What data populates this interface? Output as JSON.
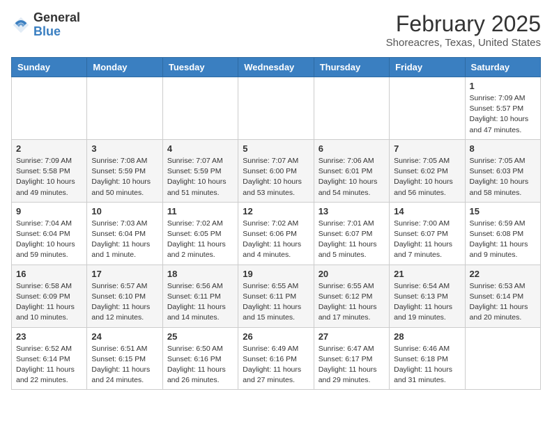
{
  "header": {
    "logo_general": "General",
    "logo_blue": "Blue",
    "month_year": "February 2025",
    "location": "Shoreacres, Texas, United States"
  },
  "weekdays": [
    "Sunday",
    "Monday",
    "Tuesday",
    "Wednesday",
    "Thursday",
    "Friday",
    "Saturday"
  ],
  "weeks": [
    [
      {
        "day": "",
        "info": ""
      },
      {
        "day": "",
        "info": ""
      },
      {
        "day": "",
        "info": ""
      },
      {
        "day": "",
        "info": ""
      },
      {
        "day": "",
        "info": ""
      },
      {
        "day": "",
        "info": ""
      },
      {
        "day": "1",
        "info": "Sunrise: 7:09 AM\nSunset: 5:57 PM\nDaylight: 10 hours and 47 minutes."
      }
    ],
    [
      {
        "day": "2",
        "info": "Sunrise: 7:09 AM\nSunset: 5:58 PM\nDaylight: 10 hours and 49 minutes."
      },
      {
        "day": "3",
        "info": "Sunrise: 7:08 AM\nSunset: 5:59 PM\nDaylight: 10 hours and 50 minutes."
      },
      {
        "day": "4",
        "info": "Sunrise: 7:07 AM\nSunset: 5:59 PM\nDaylight: 10 hours and 51 minutes."
      },
      {
        "day": "5",
        "info": "Sunrise: 7:07 AM\nSunset: 6:00 PM\nDaylight: 10 hours and 53 minutes."
      },
      {
        "day": "6",
        "info": "Sunrise: 7:06 AM\nSunset: 6:01 PM\nDaylight: 10 hours and 54 minutes."
      },
      {
        "day": "7",
        "info": "Sunrise: 7:05 AM\nSunset: 6:02 PM\nDaylight: 10 hours and 56 minutes."
      },
      {
        "day": "8",
        "info": "Sunrise: 7:05 AM\nSunset: 6:03 PM\nDaylight: 10 hours and 58 minutes."
      }
    ],
    [
      {
        "day": "9",
        "info": "Sunrise: 7:04 AM\nSunset: 6:04 PM\nDaylight: 10 hours and 59 minutes."
      },
      {
        "day": "10",
        "info": "Sunrise: 7:03 AM\nSunset: 6:04 PM\nDaylight: 11 hours and 1 minute."
      },
      {
        "day": "11",
        "info": "Sunrise: 7:02 AM\nSunset: 6:05 PM\nDaylight: 11 hours and 2 minutes."
      },
      {
        "day": "12",
        "info": "Sunrise: 7:02 AM\nSunset: 6:06 PM\nDaylight: 11 hours and 4 minutes."
      },
      {
        "day": "13",
        "info": "Sunrise: 7:01 AM\nSunset: 6:07 PM\nDaylight: 11 hours and 5 minutes."
      },
      {
        "day": "14",
        "info": "Sunrise: 7:00 AM\nSunset: 6:07 PM\nDaylight: 11 hours and 7 minutes."
      },
      {
        "day": "15",
        "info": "Sunrise: 6:59 AM\nSunset: 6:08 PM\nDaylight: 11 hours and 9 minutes."
      }
    ],
    [
      {
        "day": "16",
        "info": "Sunrise: 6:58 AM\nSunset: 6:09 PM\nDaylight: 11 hours and 10 minutes."
      },
      {
        "day": "17",
        "info": "Sunrise: 6:57 AM\nSunset: 6:10 PM\nDaylight: 11 hours and 12 minutes."
      },
      {
        "day": "18",
        "info": "Sunrise: 6:56 AM\nSunset: 6:11 PM\nDaylight: 11 hours and 14 minutes."
      },
      {
        "day": "19",
        "info": "Sunrise: 6:55 AM\nSunset: 6:11 PM\nDaylight: 11 hours and 15 minutes."
      },
      {
        "day": "20",
        "info": "Sunrise: 6:55 AM\nSunset: 6:12 PM\nDaylight: 11 hours and 17 minutes."
      },
      {
        "day": "21",
        "info": "Sunrise: 6:54 AM\nSunset: 6:13 PM\nDaylight: 11 hours and 19 minutes."
      },
      {
        "day": "22",
        "info": "Sunrise: 6:53 AM\nSunset: 6:14 PM\nDaylight: 11 hours and 20 minutes."
      }
    ],
    [
      {
        "day": "23",
        "info": "Sunrise: 6:52 AM\nSunset: 6:14 PM\nDaylight: 11 hours and 22 minutes."
      },
      {
        "day": "24",
        "info": "Sunrise: 6:51 AM\nSunset: 6:15 PM\nDaylight: 11 hours and 24 minutes."
      },
      {
        "day": "25",
        "info": "Sunrise: 6:50 AM\nSunset: 6:16 PM\nDaylight: 11 hours and 26 minutes."
      },
      {
        "day": "26",
        "info": "Sunrise: 6:49 AM\nSunset: 6:16 PM\nDaylight: 11 hours and 27 minutes."
      },
      {
        "day": "27",
        "info": "Sunrise: 6:47 AM\nSunset: 6:17 PM\nDaylight: 11 hours and 29 minutes."
      },
      {
        "day": "28",
        "info": "Sunrise: 6:46 AM\nSunset: 6:18 PM\nDaylight: 11 hours and 31 minutes."
      },
      {
        "day": "",
        "info": ""
      }
    ]
  ]
}
